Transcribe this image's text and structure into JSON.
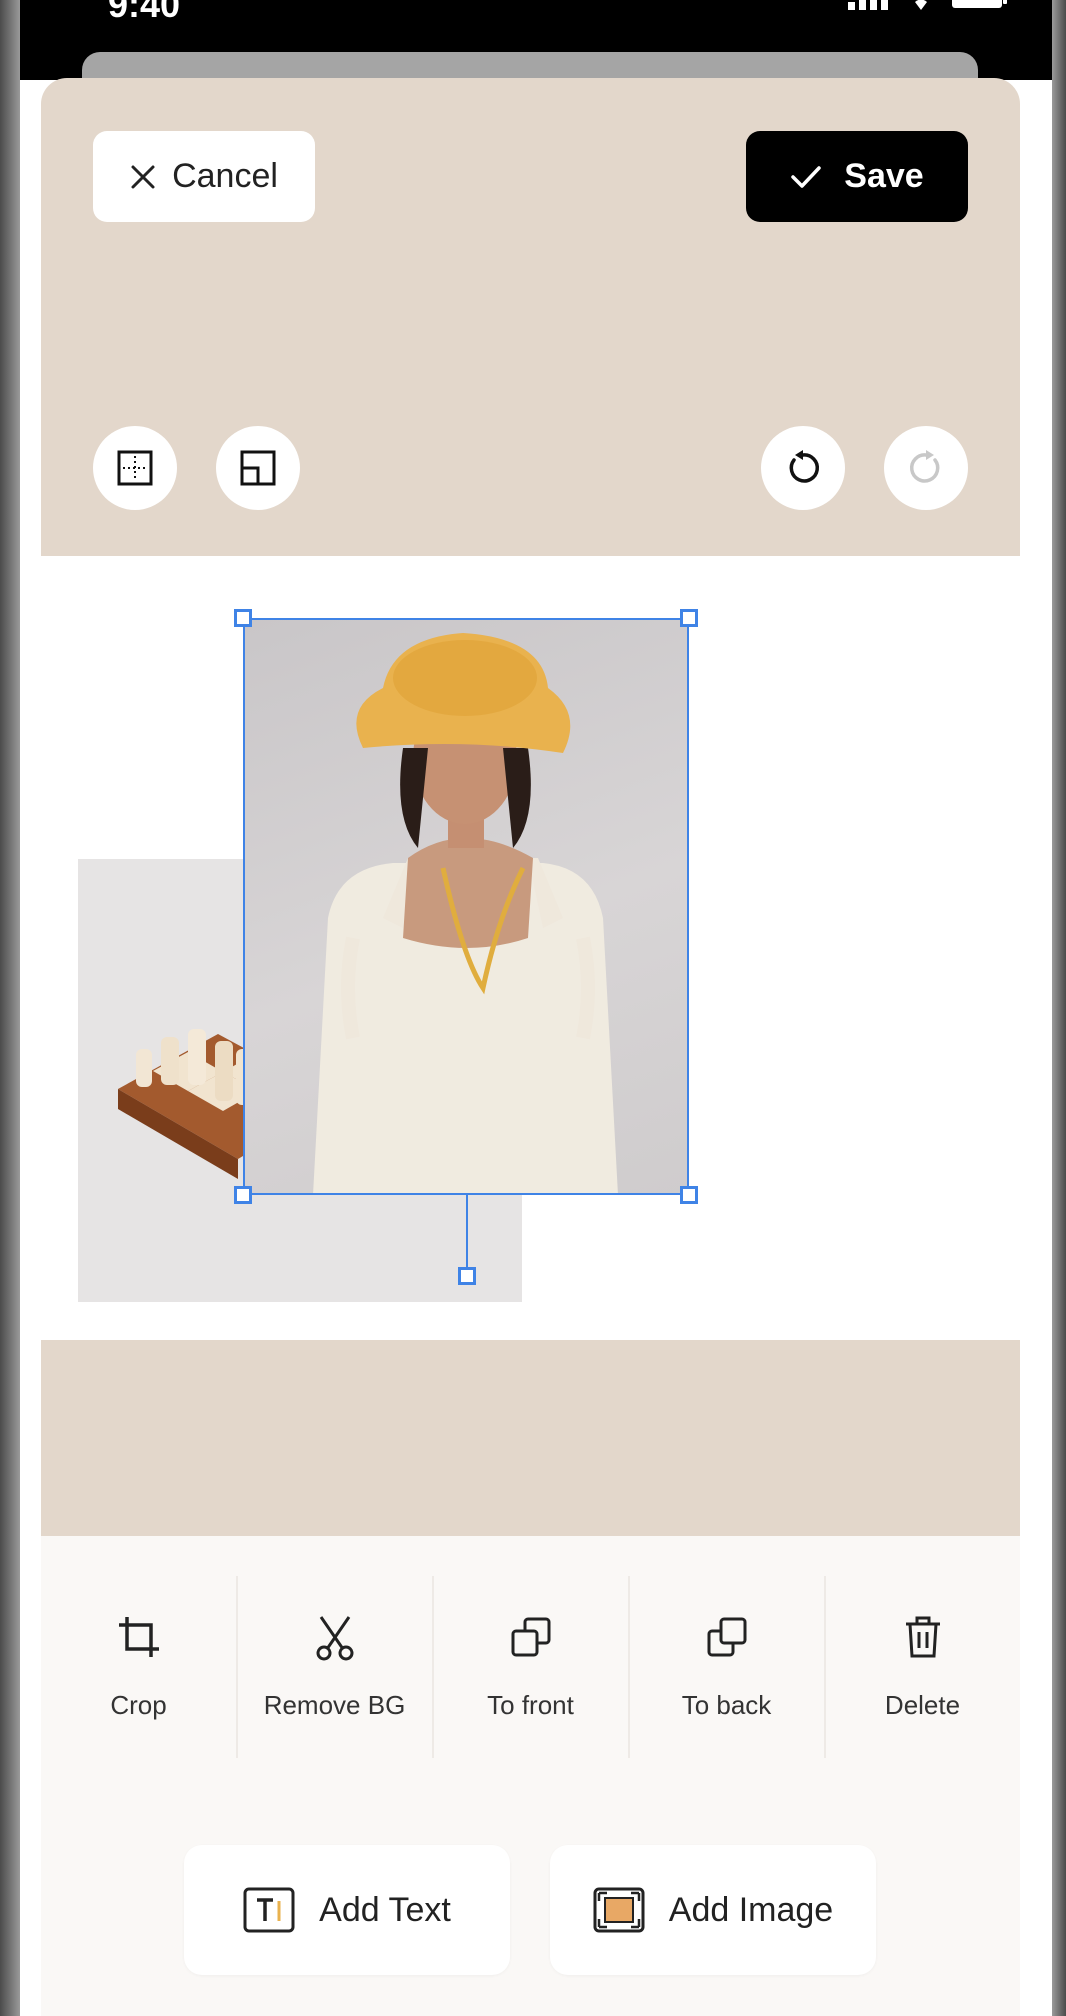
{
  "status_bar": {
    "time": "9:40"
  },
  "header": {
    "cancel_label": "Cancel",
    "save_label": "Save"
  },
  "controls": {
    "left": [
      "grid-icon",
      "layout-icon"
    ],
    "right": [
      "undo-icon",
      "redo-icon"
    ]
  },
  "toolbar": {
    "tools": [
      {
        "label": "Crop",
        "icon": "crop-icon"
      },
      {
        "label": "Remove BG",
        "icon": "scissors-icon"
      },
      {
        "label": "To front",
        "icon": "bring-to-front-icon"
      },
      {
        "label": "To back",
        "icon": "send-to-back-icon"
      },
      {
        "label": "Delete",
        "icon": "trash-icon"
      }
    ]
  },
  "bottom": {
    "add_text_label": "Add Text",
    "add_image_label": "Add Image"
  },
  "colors": {
    "editor_bg": "#e3d7cb",
    "selection": "#3f83e6",
    "save_bg": "#000000",
    "hat": "#e9b24e"
  }
}
